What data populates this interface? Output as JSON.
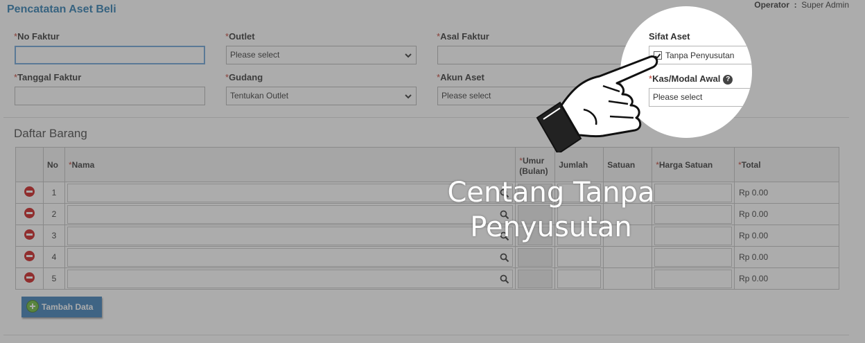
{
  "header": {
    "title": "Pencatatan Aset Beli",
    "operator_label": "Operator",
    "operator_sep": ":",
    "operator_value": "Super Admin"
  },
  "form": {
    "no_faktur_label": "No Faktur",
    "outlet_label": "Outlet",
    "outlet_value": "Please select",
    "asal_faktur_label": "Asal Faktur",
    "sifat_aset_label": "Sifat Aset",
    "tanpa_penyusutan_label": "Tanpa Penyusutan",
    "tanpa_penyusutan_checked": true,
    "tanggal_faktur_label": "Tanggal Faktur",
    "gudang_label": "Gudang",
    "gudang_value": "Tentukan Outlet",
    "akun_aset_label": "Akun Aset",
    "akun_aset_value": "Please select",
    "kas_modal_label": "Kas/Modal Awal",
    "kas_modal_value": "Please select",
    "required_mark": "*",
    "help_glyph": "?"
  },
  "table": {
    "section_title": "Daftar Barang",
    "headers": {
      "no": "No",
      "nama": "Nama",
      "umur": "Umur (Bulan)",
      "jumlah": "Jumlah",
      "satuan": "Satuan",
      "harga": "Harga Satuan",
      "total": "Total"
    },
    "rows": [
      {
        "no": "1",
        "total": "Rp 0.00"
      },
      {
        "no": "2",
        "total": "Rp 0.00"
      },
      {
        "no": "3",
        "total": "Rp 0.00"
      },
      {
        "no": "4",
        "total": "Rp 0.00"
      },
      {
        "no": "5",
        "total": "Rp 0.00"
      }
    ]
  },
  "actions": {
    "add_label": "Tambah Data"
  },
  "tutorial": {
    "caption_line1": "Centang Tanpa",
    "caption_line2": "Penyusutan"
  },
  "colors": {
    "title": "#2a7ab0",
    "required": "#c0392b",
    "remove": "#cc1a1a",
    "add_button": "#3a7db6"
  }
}
